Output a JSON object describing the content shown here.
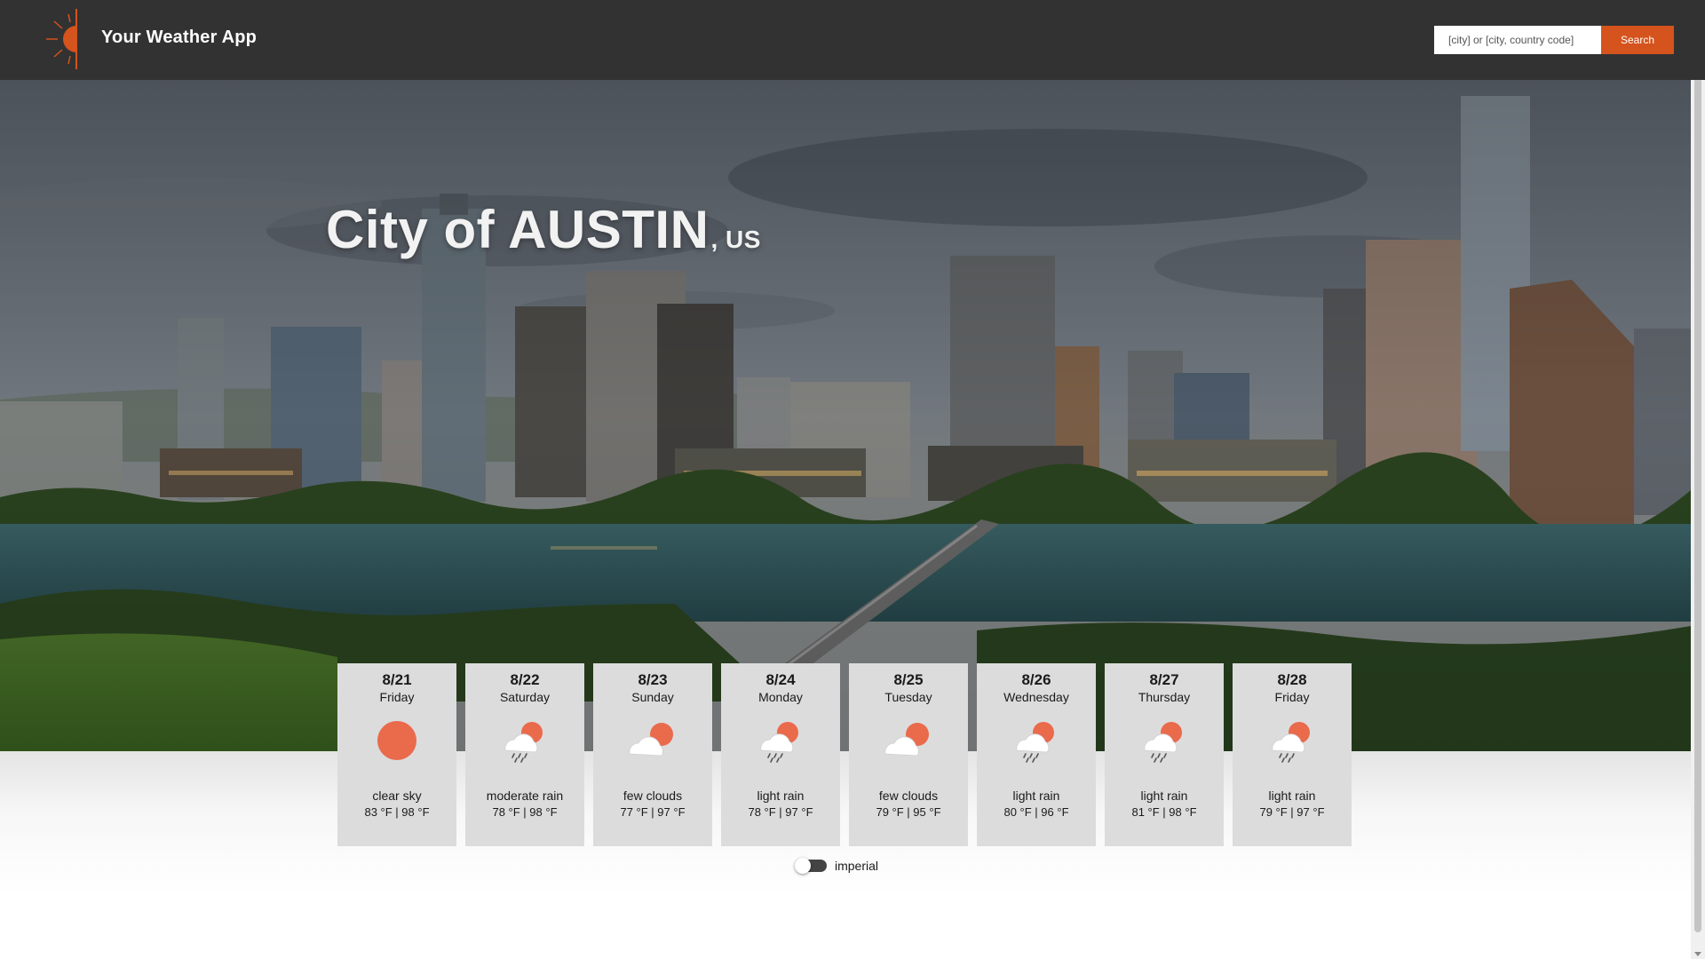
{
  "app": {
    "title": "Your Weather App"
  },
  "search": {
    "placeholder": "[city] or [city, country code]",
    "value": "",
    "button_label": "Search"
  },
  "location": {
    "city": "City of AUSTIN",
    "country": ", US"
  },
  "forecast": [
    {
      "date": "8/21",
      "weekday": "Friday",
      "description": "clear sky",
      "temps": "83 °F | 98 °F",
      "icon": "sun-icon"
    },
    {
      "date": "8/22",
      "weekday": "Saturday",
      "description": "moderate rain",
      "temps": "78 °F | 98 °F",
      "icon": "rain-cloud-sun-icon"
    },
    {
      "date": "8/23",
      "weekday": "Sunday",
      "description": "few clouds",
      "temps": "77 °F | 97 °F",
      "icon": "cloud-sun-icon"
    },
    {
      "date": "8/24",
      "weekday": "Monday",
      "description": "light rain",
      "temps": "78 °F | 97 °F",
      "icon": "rain-cloud-sun-icon"
    },
    {
      "date": "8/25",
      "weekday": "Tuesday",
      "description": "few clouds",
      "temps": "79 °F | 95 °F",
      "icon": "cloud-sun-icon"
    },
    {
      "date": "8/26",
      "weekday": "Wednesday",
      "description": "light rain",
      "temps": "80 °F | 96 °F",
      "icon": "rain-cloud-sun-icon"
    },
    {
      "date": "8/27",
      "weekday": "Thursday",
      "description": "light rain",
      "temps": "81 °F | 98 °F",
      "icon": "rain-cloud-sun-icon"
    },
    {
      "date": "8/28",
      "weekday": "Friday",
      "description": "light rain",
      "temps": "79 °F | 97 °F",
      "icon": "rain-cloud-sun-icon"
    }
  ],
  "units": {
    "label": "imperial",
    "metric_enabled": false
  },
  "colors": {
    "topbar": "#323232",
    "accent": "#d5531c",
    "sun": "#ea6a4c",
    "card": "#dcdcdc"
  }
}
